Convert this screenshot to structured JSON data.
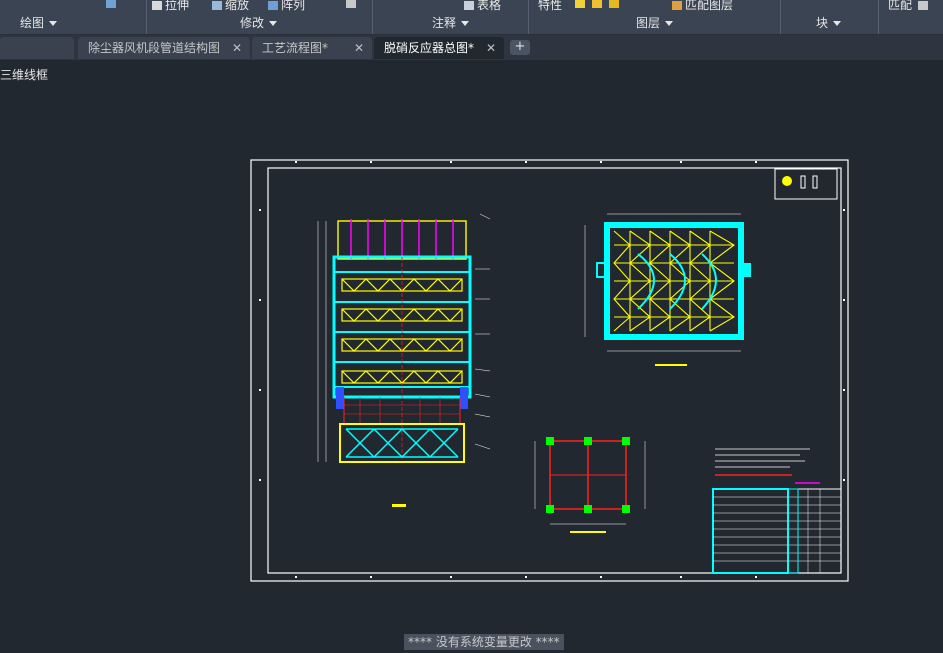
{
  "ribbon": {
    "top_items": [
      {
        "label": "拉伸",
        "icon": "stretch-icon"
      },
      {
        "label": "缩放",
        "icon": "scale-icon"
      },
      {
        "label": "阵列",
        "icon": "array-icon"
      },
      {
        "label": "表格",
        "icon": "table-icon"
      },
      {
        "label": "特性",
        "icon": "properties-icon"
      },
      {
        "label": "匹配图层",
        "icon": "match-layer-icon"
      },
      {
        "label": "匹配",
        "icon": "match-icon"
      }
    ],
    "panels": [
      "绘图",
      "修改",
      "注释",
      "图层",
      "块"
    ]
  },
  "tabs": [
    {
      "label": "除尘器风机段管道结构图",
      "active": false
    },
    {
      "label": "工艺流程图*",
      "active": false
    },
    {
      "label": "脱硝反应器总图*",
      "active": true
    }
  ],
  "new_tab_label": "+",
  "close_glyph": "✕",
  "viewport_label": "三维线框",
  "command_status": "**** 没有系统变量更改 ****",
  "colors": {
    "background": "#212830",
    "frame": "#ffffff",
    "cyan": "#00ffff",
    "yellow": "#ffff00",
    "red": "#ff2020",
    "magenta": "#ff00ff",
    "green": "#00ff00"
  }
}
